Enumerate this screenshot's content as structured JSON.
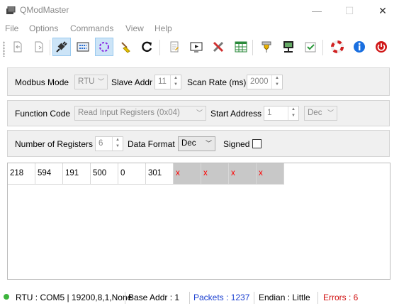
{
  "window": {
    "title": "QModMaster",
    "minimize": "—",
    "maximize": "☐",
    "close": "✕"
  },
  "menu": [
    "File",
    "Options",
    "Commands",
    "View",
    "Help"
  ],
  "toolbar": [
    {
      "name": "open-icon",
      "active": false
    },
    {
      "name": "save-icon",
      "active": false
    },
    {
      "name": "connect-icon",
      "active": true
    },
    {
      "name": "read-write-icon",
      "active": false
    },
    {
      "name": "scan-icon",
      "active": true
    },
    {
      "name": "clear-icon",
      "active": false
    },
    {
      "name": "reset-counters-icon",
      "active": false
    },
    {
      "name": "log-icon",
      "active": false
    },
    {
      "name": "bus-monitor-icon",
      "active": false
    },
    {
      "name": "tools-icon",
      "active": false
    },
    {
      "name": "table-icon",
      "active": false
    },
    {
      "name": "serial-settings-icon",
      "active": false
    },
    {
      "name": "tcp-settings-icon",
      "active": false
    },
    {
      "name": "settings-icon",
      "active": false
    },
    {
      "name": "help-icon",
      "active": false
    },
    {
      "name": "info-icon",
      "active": false
    },
    {
      "name": "exit-icon",
      "active": false
    }
  ],
  "row1": {
    "modbus_mode_label": "Modbus Mode",
    "modbus_mode_value": "RTU",
    "slave_addr_label": "Slave Addr",
    "slave_addr_value": "11",
    "scan_rate_label": "Scan Rate (ms)",
    "scan_rate_value": "2000"
  },
  "row2": {
    "function_code_label": "Function Code",
    "function_code_value": "Read Input Registers (0x04)",
    "start_address_label": "Start Address",
    "start_address_value": "1",
    "start_address_format": "Dec"
  },
  "row3": {
    "num_registers_label": "Number of Registers",
    "num_registers_value": "6",
    "data_format_label": "Data Format",
    "data_format_value": "Dec",
    "signed_label": "Signed",
    "signed_checked": false
  },
  "registers": [
    "218",
    "594",
    "191",
    "500",
    "0",
    "301",
    "x",
    "x",
    "x",
    "x"
  ],
  "status": {
    "connection": "RTU : COM5 | 19200,8,1,None",
    "base_addr": "Base Addr : 1",
    "packets": "Packets : 1237",
    "endian": "Endian : Little",
    "errors": "Errors : 6"
  },
  "colors": {
    "packets": "#1a3fd0",
    "errors": "#d01010",
    "error_cell_bg": "#c8c8c8",
    "status_led": "#3cb43c"
  }
}
